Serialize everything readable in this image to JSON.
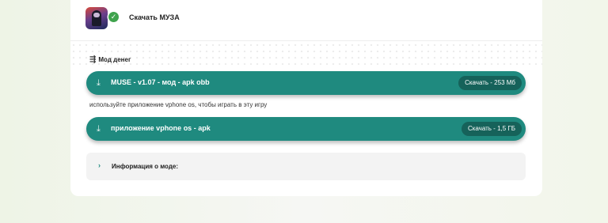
{
  "header": {
    "app_title": "Скачать МУЗА",
    "app_icon": "app-icon",
    "verified_icon": "check-badge-icon",
    "verified_glyph": "✓"
  },
  "mod_section": {
    "label": "Мод денег",
    "icon": "list-icon",
    "icon_glyph": "⇶"
  },
  "downloads": [
    {
      "icon_glyph": "⤓",
      "label": "MUSE - v1.07 - мод - apk obb",
      "badge": "Скачать - 253 Мб"
    },
    {
      "icon_glyph": "⤓",
      "label": "приложение vphone os - apk",
      "badge": "Скачать - 1,5 ГБ"
    }
  ],
  "note": "используйте приложение vphone os, чтобы играть в эту игру",
  "info": {
    "chevron_glyph": "›",
    "label": "Информация о моде:"
  },
  "colors": {
    "button": "#1f8a7f",
    "badge": "#16625a",
    "verified": "#3fa34d"
  }
}
